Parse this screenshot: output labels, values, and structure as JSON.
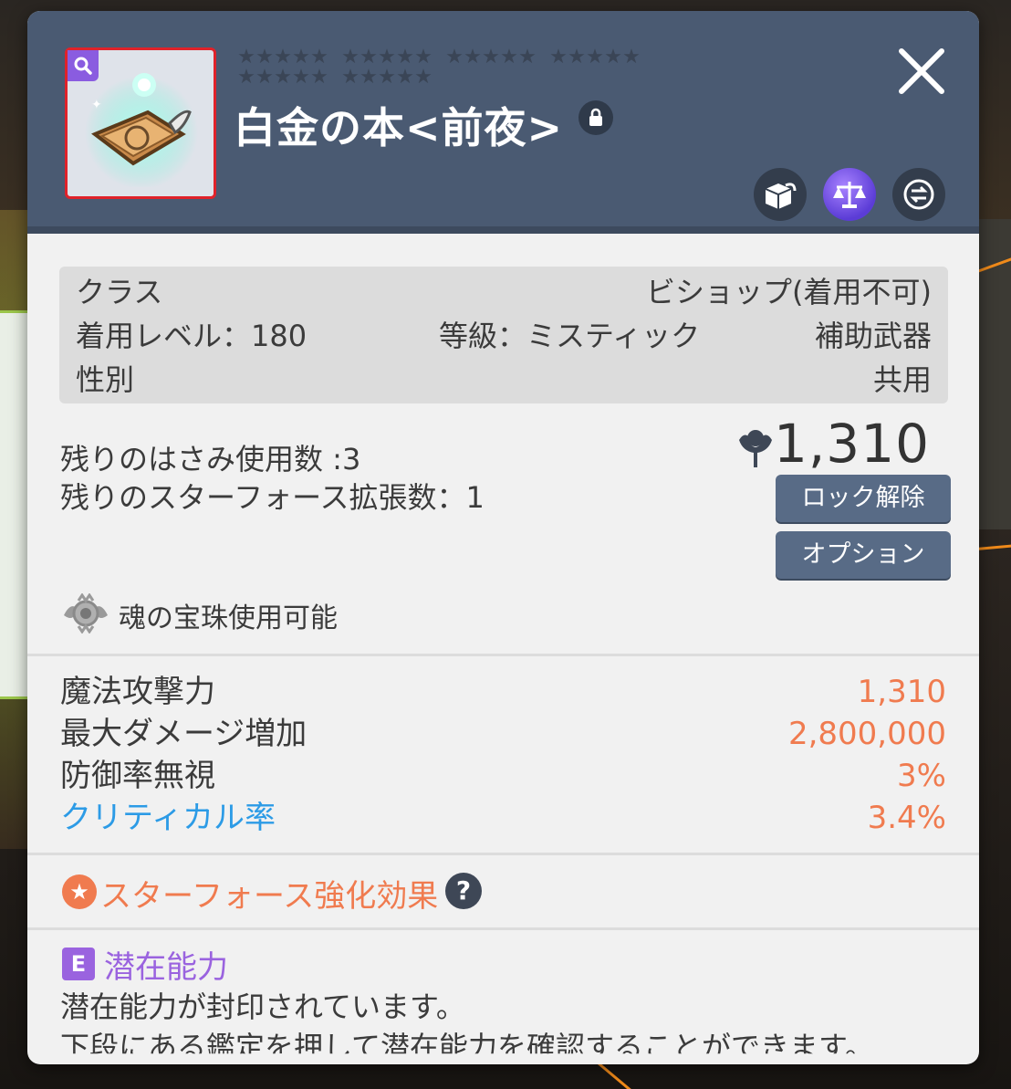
{
  "item": {
    "name": "白金の本<前夜>",
    "frame_color": "#e0222a"
  },
  "header": {
    "stars_row1": [
      5,
      5,
      5,
      5
    ],
    "stars_row2": [
      5,
      5
    ]
  },
  "info": {
    "class_label": "クラス",
    "class_value": "ビショップ(着用不可)",
    "level_text": "着用レベル：180",
    "grade_text": "等級：ミスティック",
    "type_value": "補助武器",
    "gender_label": "性別",
    "gender_value": "共用"
  },
  "remaining": {
    "scissors": "残りのはさみ使用数 :3",
    "starforce_ext": "残りのスターフォース拡張数：1"
  },
  "power": {
    "value": "1,310"
  },
  "buttons": {
    "unlock": "ロック解除",
    "option": "オプション"
  },
  "soul": {
    "text": "魂の宝珠使用可能"
  },
  "stats": [
    {
      "key": "魔法攻撃力",
      "value": "1,310"
    },
    {
      "key": "最大ダメージ増加",
      "value": "2,800,000"
    },
    {
      "key": "防御率無視",
      "value": "3%"
    },
    {
      "key": "クリティカル率",
      "value": "3.4%"
    }
  ],
  "starforce": {
    "label": "スターフォース強化効果"
  },
  "potential": {
    "grade": "E",
    "title": "潜在能力",
    "line1": "潜在能力が封印されています。",
    "line2": "下段にある鑑定を押して潜在能力を確認することができます。"
  },
  "colors": {
    "header": "#4a5a72",
    "value_orange": "#f07b4f",
    "potential_purple": "#9a63df",
    "crit_blue": "#2c9be6"
  }
}
